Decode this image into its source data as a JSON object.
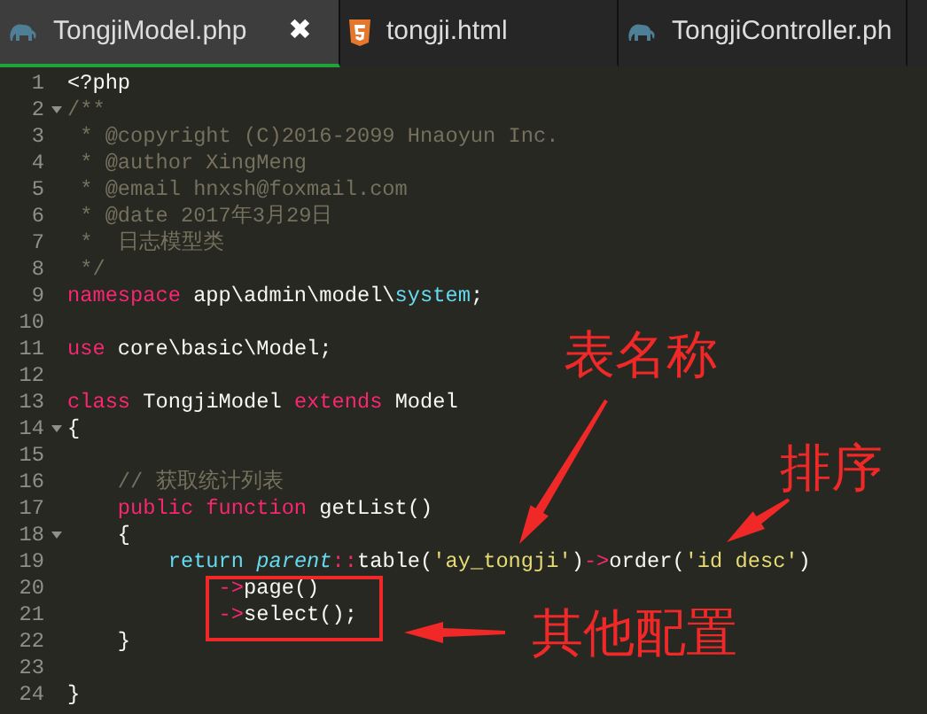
{
  "tabs": [
    {
      "label": "TongjiModel.php",
      "kind": "php",
      "selected": true,
      "close": "✖"
    },
    {
      "label": "tongji.html",
      "kind": "html",
      "selected": false
    },
    {
      "label": "TongjiController.ph",
      "kind": "php",
      "selected": false
    }
  ],
  "lines": [
    {
      "number": "1",
      "fold": false,
      "tokens": [
        {
          "kind": "plain",
          "text": "<?php"
        }
      ]
    },
    {
      "number": "2",
      "fold": true,
      "tokens": [
        {
          "kind": "comment",
          "text": "/**"
        }
      ]
    },
    {
      "number": "3",
      "fold": false,
      "tokens": [
        {
          "kind": "comment",
          "text": " * @copyright (C)2016-2099 Hnaoyun Inc."
        }
      ]
    },
    {
      "number": "4",
      "fold": false,
      "tokens": [
        {
          "kind": "comment",
          "text": " * @author XingMeng"
        }
      ]
    },
    {
      "number": "5",
      "fold": false,
      "tokens": [
        {
          "kind": "comment",
          "text": " * @email hnxsh@foxmail.com"
        }
      ]
    },
    {
      "number": "6",
      "fold": false,
      "tokens": [
        {
          "kind": "comment",
          "text": " * @date 2017年3月29日"
        }
      ]
    },
    {
      "number": "7",
      "fold": false,
      "tokens": [
        {
          "kind": "comment",
          "text": " *  日志模型类"
        }
      ]
    },
    {
      "number": "8",
      "fold": false,
      "tokens": [
        {
          "kind": "comment",
          "text": " */"
        }
      ]
    },
    {
      "number": "9",
      "fold": false,
      "tokens": [
        {
          "kind": "keyword",
          "text": "namespace"
        },
        {
          "kind": "plain",
          "text": " app\\admin\\model\\"
        },
        {
          "kind": "type",
          "text": "system"
        },
        {
          "kind": "plain",
          "text": ";"
        }
      ]
    },
    {
      "number": "10",
      "fold": false
    },
    {
      "number": "11",
      "fold": false,
      "tokens": [
        {
          "kind": "keyword",
          "text": "use"
        },
        {
          "kind": "plain",
          "text": " core\\basic\\Model;"
        }
      ]
    },
    {
      "number": "12",
      "fold": false
    },
    {
      "number": "13",
      "fold": false,
      "tokens": [
        {
          "kind": "keyword",
          "text": "class"
        },
        {
          "kind": "plain",
          "text": " TongjiModel "
        },
        {
          "kind": "keyword",
          "text": "extends"
        },
        {
          "kind": "plain",
          "text": " Model"
        }
      ]
    },
    {
      "number": "14",
      "fold": true,
      "tokens": [
        {
          "kind": "plain",
          "text": "{"
        }
      ]
    },
    {
      "number": "15",
      "fold": false
    },
    {
      "number": "16",
      "fold": false,
      "tokens": [
        {
          "kind": "comment",
          "text": "    // 获取统计列表"
        }
      ]
    },
    {
      "number": "17",
      "fold": false,
      "tokens": [
        {
          "kind": "keyword",
          "text": "    public function"
        },
        {
          "kind": "plain",
          "text": " getList()"
        }
      ]
    },
    {
      "number": "18",
      "fold": true,
      "tokens": [
        {
          "kind": "plain",
          "text": "    {"
        }
      ]
    },
    {
      "number": "19",
      "fold": false,
      "tokens": [
        {
          "kind": "type",
          "text": "        return "
        },
        {
          "kind": "italic",
          "text": "parent"
        },
        {
          "kind": "keyword",
          "text": "::"
        },
        {
          "kind": "plain",
          "text": "table("
        },
        {
          "kind": "string",
          "text": "'ay_tongji'"
        },
        {
          "kind": "plain",
          "text": ")"
        },
        {
          "kind": "keyword",
          "text": "->"
        },
        {
          "kind": "plain",
          "text": "order("
        },
        {
          "kind": "string",
          "text": "'id desc'"
        },
        {
          "kind": "plain",
          "text": ")"
        }
      ]
    },
    {
      "number": "20",
      "fold": false,
      "tokens": [
        {
          "kind": "keyword",
          "text": "            ->"
        },
        {
          "kind": "plain",
          "text": "page()"
        }
      ]
    },
    {
      "number": "21",
      "fold": false,
      "tokens": [
        {
          "kind": "keyword",
          "text": "            ->"
        },
        {
          "kind": "plain",
          "text": "select();"
        }
      ]
    },
    {
      "number": "22",
      "fold": false,
      "tokens": [
        {
          "kind": "plain",
          "text": "    }"
        }
      ]
    },
    {
      "number": "23",
      "fold": false
    },
    {
      "number": "24",
      "fold": false,
      "tokens": [
        {
          "kind": "plain",
          "text": "}"
        }
      ]
    }
  ],
  "annotations": [
    {
      "text": "表名称"
    },
    {
      "text": "排序"
    },
    {
      "text": "其他配置"
    }
  ]
}
